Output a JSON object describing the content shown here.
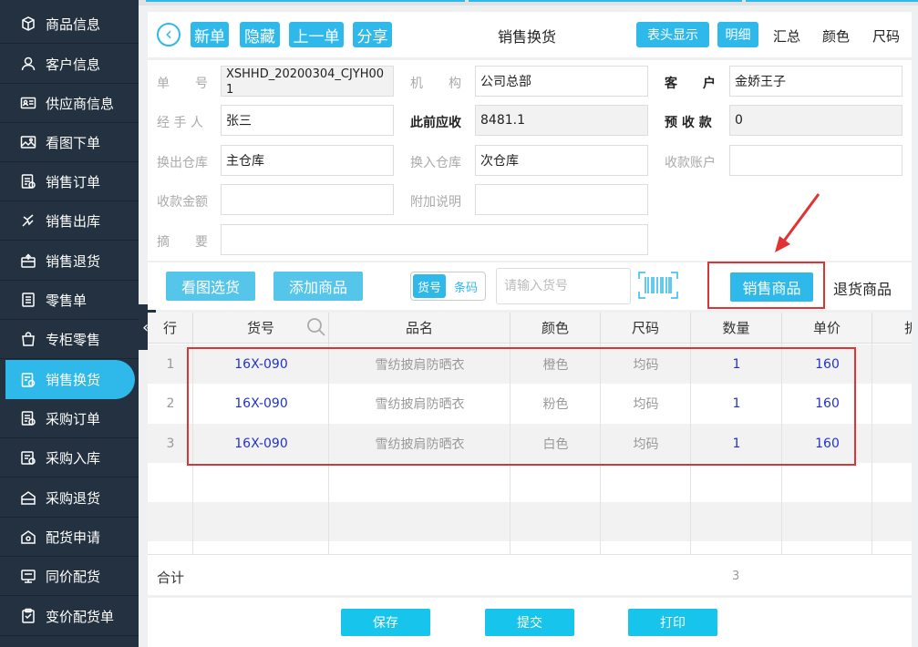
{
  "sidebar": {
    "items": [
      {
        "label": "商品信息",
        "icon": "box-icon"
      },
      {
        "label": "客户信息",
        "icon": "user-icon"
      },
      {
        "label": "供应商信息",
        "icon": "id-card-icon"
      },
      {
        "label": "看图下单",
        "icon": "image-icon"
      },
      {
        "label": "销售订单",
        "icon": "order-icon"
      },
      {
        "label": "销售出库",
        "icon": "outbound-icon"
      },
      {
        "label": "销售退货",
        "icon": "return-icon"
      },
      {
        "label": "零售单",
        "icon": "receipt-icon"
      },
      {
        "label": "专柜零售",
        "icon": "bag-icon"
      },
      {
        "label": "销售换货",
        "icon": "exchange-icon"
      },
      {
        "label": "采购订单",
        "icon": "purchase-order-icon"
      },
      {
        "label": "采购入库",
        "icon": "inbound-icon"
      },
      {
        "label": "采购退货",
        "icon": "purchase-return-icon"
      },
      {
        "label": "配货申请",
        "icon": "distribution-icon"
      },
      {
        "label": "同价配货",
        "icon": "same-price-icon"
      },
      {
        "label": "变价配货单",
        "icon": "clipboard-icon"
      }
    ],
    "active_index": 9,
    "collapse_glyph": "«"
  },
  "header": {
    "back_glyph": "‹",
    "new_label": "新单",
    "hide_label": "隐藏",
    "prev_label": "上一单",
    "share_label": "分享",
    "title": "销售换货",
    "header_display_label": "表头显示",
    "detail_label": "明细",
    "summary_label": "汇总",
    "color_label": "颜色",
    "size_label": "尺码"
  },
  "form": {
    "order_no_label": "单　　号",
    "order_no_value": "XSHHD_20200304_CJYH001",
    "org_label": "机　　构",
    "org_value": "公司总部",
    "customer_label": "客　　户",
    "customer_value": "金娇王子",
    "handler_label": "经 手 人",
    "handler_value": "张三",
    "prev_receivable_label": "此前应收",
    "prev_receivable_value": "8481.1",
    "advance_label": "预 收 款",
    "advance_value": "0",
    "out_wh_label": "换出仓库",
    "out_wh_value": "主仓库",
    "in_wh_label": "换入仓库",
    "in_wh_value": "次仓库",
    "account_label": "收款账户",
    "account_value": "",
    "amount_label": "收款金额",
    "amount_value": "",
    "note_label": "附加说明",
    "note_value": "",
    "summary_label": "摘　　要",
    "summary_value": ""
  },
  "toolbar": {
    "pick_by_image_label": "看图选货",
    "add_product_label": "添加商品",
    "toggle_on": "货号",
    "toggle_off": "条码",
    "scan_placeholder": "请输入货号",
    "sales_product_label": "销售商品",
    "return_product_label": "退货商品"
  },
  "table": {
    "headers": [
      "行",
      "货号",
      "品名",
      "颜色",
      "尺码",
      "数量",
      "单价",
      "折"
    ],
    "rows": [
      {
        "no": "1",
        "code": "16X-090",
        "name": "雪纺披肩防晒衣",
        "color": "橙色",
        "size": "均码",
        "qty": "1",
        "price": "160"
      },
      {
        "no": "2",
        "code": "16X-090",
        "name": "雪纺披肩防晒衣",
        "color": "粉色",
        "size": "均码",
        "qty": "1",
        "price": "160"
      },
      {
        "no": "3",
        "code": "16X-090",
        "name": "雪纺披肩防晒衣",
        "color": "白色",
        "size": "均码",
        "qty": "1",
        "price": "160"
      }
    ],
    "total_label": "合计",
    "total_qty": "3"
  },
  "footer": {
    "save_label": "保存",
    "submit_label": "提交",
    "print_label": "打印"
  },
  "colors": {
    "accent": "#2fb9ea",
    "sidebar_bg": "#233140",
    "highlight_red": "#e03333"
  }
}
